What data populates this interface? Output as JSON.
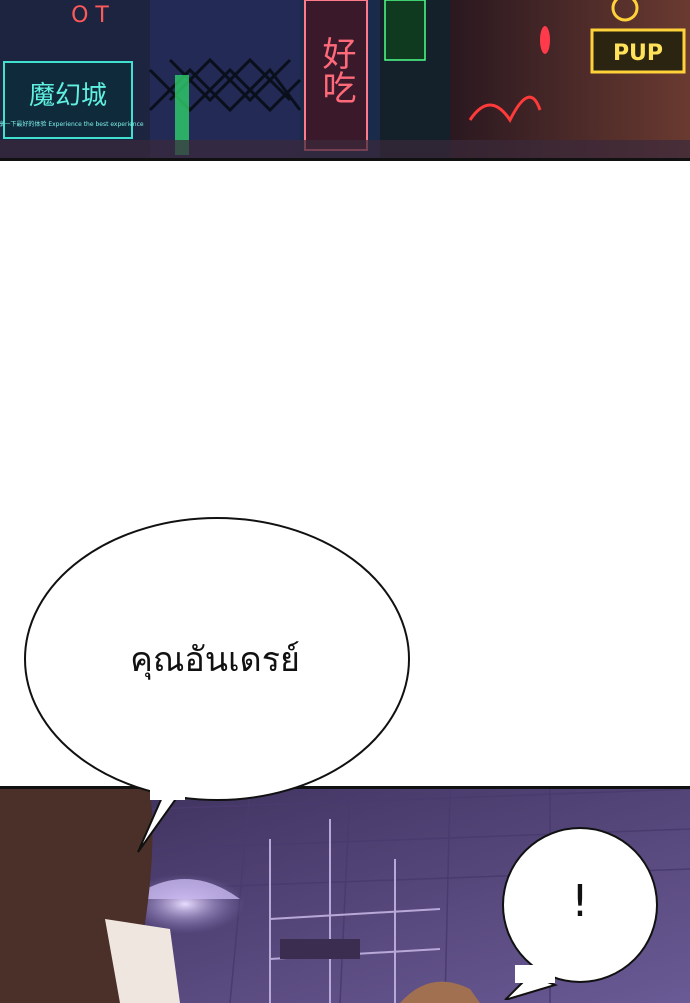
{
  "panels": {
    "top_scene": {
      "signs": {
        "left_sign_title": "魔幻城",
        "left_sign_sub": "来享一下最好的体验 Experience the best experience",
        "center_sign": "好吃",
        "right_sign": "PUP",
        "far_left_letters": "O T"
      }
    }
  },
  "dialogue": {
    "main_bubble": "คุณอันเดรย์",
    "small_bubble": "!"
  },
  "colors": {
    "night_sky": "#1a2240",
    "neon_cyan": "#3fe0d0",
    "neon_pink": "#ff4f6a",
    "neon_yellow": "#ffd23a",
    "room_purple": "#5b4a85",
    "hair_brown": "#4a3028"
  }
}
